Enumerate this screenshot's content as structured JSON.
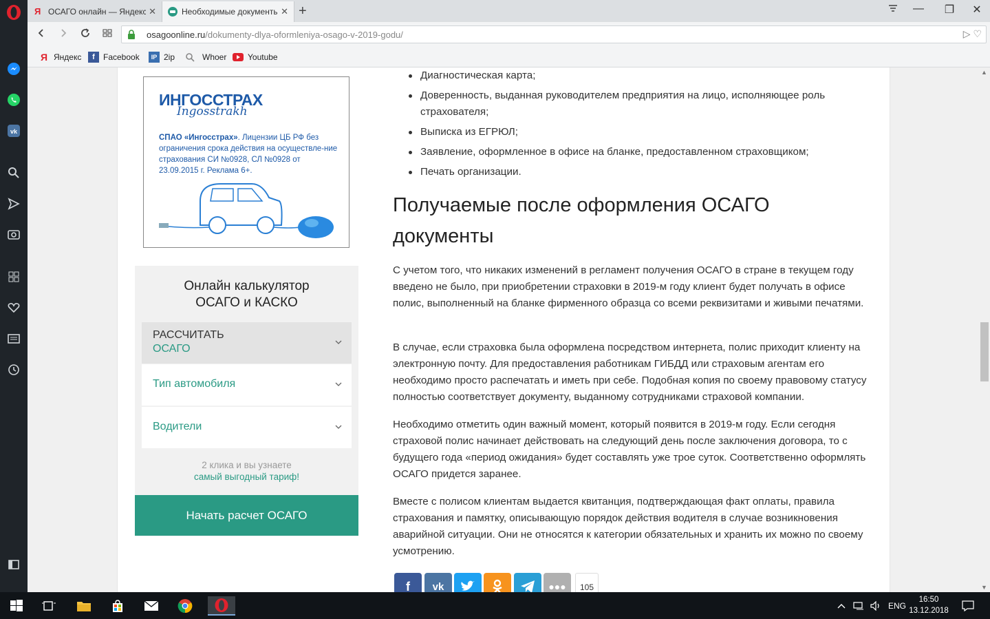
{
  "browser": {
    "tabs": [
      {
        "title": "ОСАГО онлайн — Яндекс",
        "active": false
      },
      {
        "title": "Необходимые документы",
        "active": true
      }
    ],
    "url_domain": "osagoonline.ru",
    "url_path": "/dokumenty-dlya-oformleniya-osago-v-2019-godu/",
    "bookmarks": [
      {
        "label": "Яндекс",
        "icon": "yandex-icon"
      },
      {
        "label": "Facebook",
        "icon": "facebook-icon"
      },
      {
        "label": "2ip",
        "icon": "ip-icon"
      },
      {
        "label": "Whoer",
        "icon": "search-icon"
      },
      {
        "label": "Youtube",
        "icon": "youtube-icon"
      }
    ]
  },
  "sidebar_icons": [
    "messenger-icon",
    "whatsapp-icon",
    "vk-icon",
    "search-icon",
    "send-icon",
    "camera-icon",
    "speed-dial-icon",
    "heart-icon",
    "news-icon",
    "history-icon",
    "panel-toggle-icon"
  ],
  "ad": {
    "brand": "ИНГОССТРАХ",
    "brand_latin": "Ingosstrakh",
    "company": "СПАО «Ингосстрах»",
    "license_text": ". Лицензии ЦБ РФ без ограничения срока действия на осуществле-ние страхования СИ №0928, СЛ №0928 от 23.09.2015 г. Реклама 6+."
  },
  "calculator": {
    "title_line1": "Онлайн калькулятор",
    "title_line2": "ОСАГО и КАСКО",
    "rows": [
      {
        "label": "РАССЧИТАТЬ",
        "value": "ОСАГО"
      },
      {
        "label": "Тип автомобиля"
      },
      {
        "label": "Водители"
      }
    ],
    "hint_line1": "2 клика и вы узнаете",
    "hint_link": "самый выгодный тариф!",
    "button": "Начать расчет ОСАГО"
  },
  "article": {
    "list_items": [
      "Диагностическая карта;",
      "Доверенность, выданная руководителем предприятия на лицо, исполняющее роль страхователя;",
      "Выписка из ЕГРЮЛ;",
      "Заявление, оформленное в офисе на бланке, предоставленном страховщиком;",
      "Печать организации."
    ],
    "heading": "Получаемые после оформления ОСАГО документы",
    "paragraphs": [
      "С учетом того, что никаких изменений в регламент получения ОСАГО в стране в текущем году введено не было, при приобретении страховки в 2019-м году клиент будет получать в офисе полис, выполненный на бланке фирменного образца со всеми реквизитами и живыми печатями.",
      "В случае, если страховка была оформлена посредством интернета, полис приходит клиенту на электронную почту. Для предоставления работникам ГИБДД или страховым агентам его необходимо просто распечатать и иметь при себе. Подобная копия по своему правовому статусу полностью соответствует документу, выданному сотрудниками страховой компании.",
      "Необходимо отметить один важный момент, который появится в 2019-м году. Если сегодня страховой полис начинает действовать на следующий день после заключения договора, то с будущего года «период ожидания» будет составлять уже трое суток. Соответственно оформлять ОСАГО придется заранее.",
      "Вместе с полисом клиентам выдается квитанция, подтверждающая факт оплаты, правила страхования и памятку, описывающую порядок действия водителя в случае возникновения аварийной ситуации. Они не относятся к категории обязательных и хранить их можно по своему усмотрению."
    ]
  },
  "share": {
    "count": "105",
    "buttons": [
      {
        "name": "facebook",
        "glyph": "f",
        "color": "#3b5998"
      },
      {
        "name": "vk",
        "glyph": "vk",
        "color": "#4c75a3"
      },
      {
        "name": "twitter",
        "glyph": "t",
        "color": "#1da1f2"
      },
      {
        "name": "odnoklassniki",
        "glyph": "ok",
        "color": "#f7931e"
      },
      {
        "name": "telegram",
        "glyph": "tg",
        "color": "#2a9fd6"
      },
      {
        "name": "more",
        "glyph": "•••",
        "color": "#b0b0b0"
      }
    ]
  },
  "taskbar": {
    "language": "ENG",
    "time": "16:50",
    "date": "13.12.2018"
  }
}
